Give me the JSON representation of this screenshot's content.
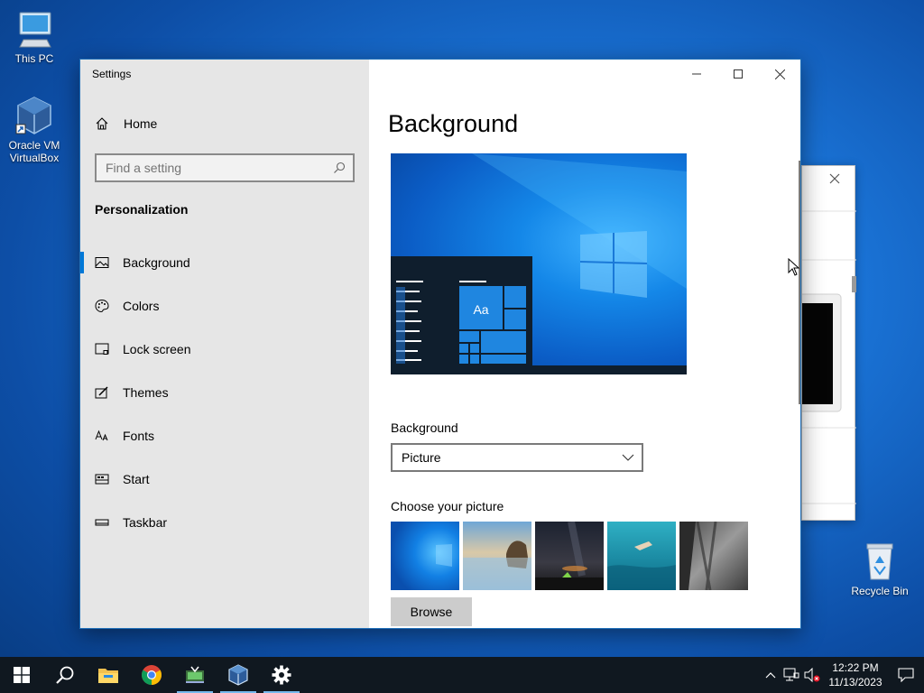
{
  "desktop": {
    "icons": [
      {
        "label": "This PC",
        "icon": "computer-icon"
      },
      {
        "label": "Oracle VM\nVirtualBox",
        "icon": "virtualbox-icon"
      },
      {
        "label": "Recycle Bin",
        "icon": "recycle-bin-icon"
      }
    ]
  },
  "settings": {
    "window_title": "Settings",
    "home_label": "Home",
    "search_placeholder": "Find a setting",
    "section_title": "Personalization",
    "nav": [
      {
        "label": "Background",
        "icon": "picture-icon",
        "active": true
      },
      {
        "label": "Colors",
        "icon": "palette-icon",
        "active": false
      },
      {
        "label": "Lock screen",
        "icon": "lock-screen-icon",
        "active": false
      },
      {
        "label": "Themes",
        "icon": "themes-icon",
        "active": false
      },
      {
        "label": "Fonts",
        "icon": "fonts-icon",
        "active": false
      },
      {
        "label": "Start",
        "icon": "start-icon",
        "active": false
      },
      {
        "label": "Taskbar",
        "icon": "taskbar-icon",
        "active": false
      }
    ],
    "page_title": "Background",
    "preview_tile_text": "Aa",
    "background_label": "Background",
    "background_value": "Picture",
    "choose_picture_label": "Choose your picture",
    "pictures": [
      "windows-blue",
      "beach-rock",
      "night-sky-tent",
      "underwater-swimmer",
      "rock-cliff"
    ],
    "browse_label": "Browse"
  },
  "taskbar": {
    "apps": [
      "start-icon",
      "search-icon",
      "file-explorer-icon",
      "chrome-icon",
      "app-icon",
      "virtualbox-icon",
      "settings-gear-icon"
    ],
    "time": "12:22 PM",
    "date": "11/13/2023"
  },
  "colors": {
    "accent": "#0078d7",
    "sidebar": "#e6e6e6",
    "taskbar": "#101820"
  }
}
